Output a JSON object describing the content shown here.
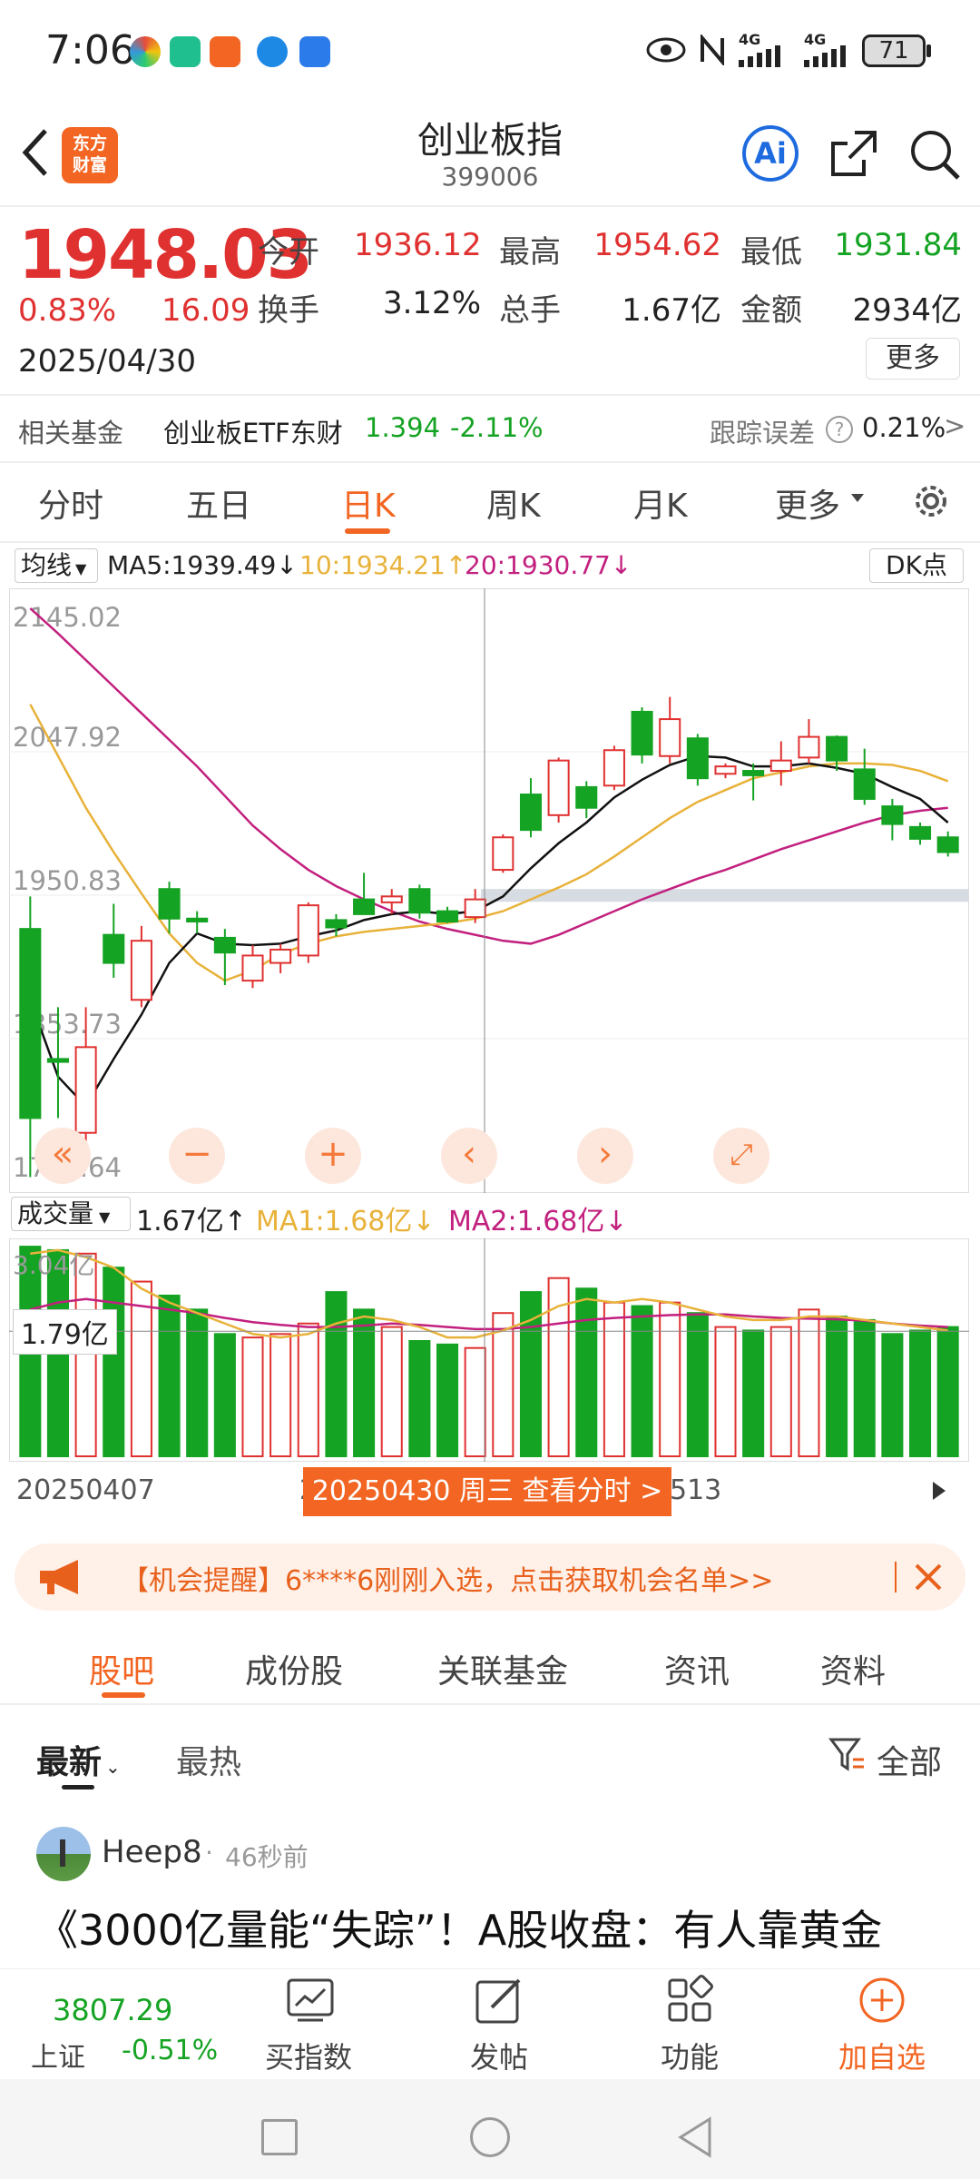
{
  "status_bar": {
    "time": "7:06",
    "network1": "4G",
    "network2": "4G",
    "battery": "71"
  },
  "header": {
    "title": "创业板指",
    "code": "399006",
    "logo_text": "东方财富",
    "ai_label": "Ai"
  },
  "quote": {
    "price": "1948.03",
    "change_pct": "0.83%",
    "change": "16.09",
    "date": "2025/04/30",
    "open_label": "今开",
    "open": "1936.12",
    "high_label": "最高",
    "high": "1954.62",
    "low_label": "最低",
    "low": "1931.84",
    "turnover_label": "换手",
    "turnover": "3.12%",
    "volume_label": "总手",
    "volume": "1.67亿",
    "amount_label": "金额",
    "amount": "2934亿",
    "more_label": "更多"
  },
  "fund": {
    "label": "相关基金",
    "name": "创业板ETF东财",
    "price": "1.394",
    "change": "-2.11%",
    "tracking_label": "跟踪误差",
    "tracking_value": "0.21%",
    "arrow": ">"
  },
  "chart_tabs": [
    "分时",
    "五日",
    "日K",
    "周K",
    "月K",
    "更多"
  ],
  "ma_bar": {
    "selector": "均线",
    "ma5": "MA5:1939.49↓",
    "ma10": "10:1934.21↑",
    "ma20": "20:1930.77↓",
    "dk": "DK点"
  },
  "vol_bar": {
    "selector": "成交量",
    "vol": "1.67亿↑",
    "ma1": "MA1:1.68亿↓",
    "ma2": "MA2:1.68亿↓",
    "tick_top": "3.04亿",
    "hover_value": "1.79亿"
  },
  "date_axis": {
    "start": "20250407",
    "pill": "20250430 周三 查看分时 >",
    "left_partial": "202",
    "right_partial": "513"
  },
  "reminder": {
    "text": "【机会提醒】6****6刚刚入选，点击获取机会名单>>"
  },
  "sub_tabs": [
    "股吧",
    "成份股",
    "关联基金",
    "资讯",
    "资料"
  ],
  "filter": {
    "latest": "最新",
    "hot": "最热",
    "all": "全部"
  },
  "post": {
    "user": "Heep8",
    "time": "46秒前",
    "title": "《3000亿量能“失踪”！A股收盘：有人靠黄金"
  },
  "bottom_bar": {
    "index_value": "3807.29",
    "index_name": "上证",
    "index_change": "-0.51%",
    "items": [
      "买指数",
      "发帖",
      "功能",
      "加自选"
    ]
  },
  "colors": {
    "up": "#e03131",
    "down": "#15a323",
    "accent": "#f26522",
    "ma5": "#111111",
    "ma10": "#e8b23a",
    "ma20": "#c2207e"
  },
  "chart_data": {
    "type": "candlestick",
    "y_ticks": [
      "2145.02",
      "2047.92",
      "1950.83",
      "1853.73",
      "1756.64"
    ],
    "ylim": [
      1756.64,
      2145.02
    ],
    "candles": [
      {
        "o": 1928,
        "c": 1800,
        "h": 1950,
        "l": 1760
      },
      {
        "o": 1840,
        "c": 1838,
        "h": 1875,
        "l": 1800
      },
      {
        "o": 1790,
        "c": 1848,
        "h": 1875,
        "l": 1770
      },
      {
        "o": 1924,
        "c": 1905,
        "h": 1945,
        "l": 1895
      },
      {
        "o": 1880,
        "c": 1920,
        "h": 1930,
        "l": 1875
      },
      {
        "o": 1955,
        "c": 1935,
        "h": 1960,
        "l": 1925
      },
      {
        "o": 1935,
        "c": 1933,
        "h": 1940,
        "l": 1925
      },
      {
        "o": 1922,
        "c": 1912,
        "h": 1928,
        "l": 1890
      },
      {
        "o": 1893,
        "c": 1910,
        "h": 1917,
        "l": 1888
      },
      {
        "o": 1905,
        "c": 1914,
        "h": 1918,
        "l": 1898
      },
      {
        "o": 1910,
        "c": 1944,
        "h": 1946,
        "l": 1905
      },
      {
        "o": 1934,
        "c": 1929,
        "h": 1938,
        "l": 1923
      },
      {
        "o": 1948,
        "c": 1938,
        "h": 1966,
        "l": 1938
      },
      {
        "o": 1946,
        "c": 1950,
        "h": 1955,
        "l": 1938
      },
      {
        "o": 1955,
        "c": 1939,
        "h": 1958,
        "l": 1935
      },
      {
        "o": 1940,
        "c": 1933,
        "h": 1943,
        "l": 1932
      },
      {
        "o": 1936,
        "c": 1948,
        "h": 1955,
        "l": 1932
      },
      {
        "o": 1968,
        "c": 1990,
        "h": 1992,
        "l": 1966
      },
      {
        "o": 2019,
        "c": 1995,
        "h": 2030,
        "l": 1990
      },
      {
        "o": 2005,
        "c": 2042,
        "h": 2044,
        "l": 2000
      },
      {
        "o": 2024,
        "c": 2010,
        "h": 2028,
        "l": 2003
      },
      {
        "o": 2025,
        "c": 2049,
        "h": 2052,
        "l": 2022
      },
      {
        "o": 2075,
        "c": 2046,
        "h": 2078,
        "l": 2040
      },
      {
        "o": 2045,
        "c": 2070,
        "h": 2085,
        "l": 2040
      },
      {
        "o": 2057,
        "c": 2030,
        "h": 2060,
        "l": 2025
      },
      {
        "o": 2033,
        "c": 2038,
        "h": 2040,
        "l": 2030
      },
      {
        "o": 2035,
        "c": 2032,
        "h": 2040,
        "l": 2015
      },
      {
        "o": 2035,
        "c": 2042,
        "h": 2055,
        "l": 2025
      },
      {
        "o": 2044,
        "c": 2058,
        "h": 2070,
        "l": 2040
      },
      {
        "o": 2058,
        "c": 2042,
        "h": 2059,
        "l": 2035
      },
      {
        "o": 2036,
        "c": 2016,
        "h": 2050,
        "l": 2012
      },
      {
        "o": 2011,
        "c": 1999,
        "h": 2016,
        "l": 1988
      },
      {
        "o": 1997,
        "c": 1989,
        "h": 2000,
        "l": 1985
      },
      {
        "o": 1990,
        "c": 1980,
        "h": 1994,
        "l": 1977
      }
    ],
    "ma5": [
      1880,
      1828,
      1808,
      1840,
      1870,
      1905,
      1925,
      1918,
      1917,
      1918,
      1923,
      1927,
      1934,
      1938,
      1940,
      1938,
      1940,
      1950,
      1969,
      1986,
      2000,
      2017,
      2029,
      2039,
      2045,
      2044,
      2038,
      2038,
      2040,
      2037,
      2033,
      2024,
      2016,
      2000
    ],
    "ma10": [
      2080,
      2045,
      2010,
      1980,
      1952,
      1925,
      1905,
      1893,
      1900,
      1911,
      1918,
      1923,
      1926,
      1928,
      1930,
      1932,
      1935,
      1940,
      1948,
      1956,
      1965,
      1977,
      1990,
      2003,
      2014,
      2022,
      2030,
      2034,
      2038,
      2040,
      2040,
      2039,
      2035,
      2028
    ],
    "ma20": [
      2145,
      2128,
      2110,
      2092,
      2074,
      2056,
      2038,
      2018,
      1998,
      1982,
      1968,
      1957,
      1948,
      1940,
      1933,
      1928,
      1924,
      1920,
      1918,
      1924,
      1932,
      1940,
      1948,
      1955,
      1962,
      1968,
      1975,
      1982,
      1988,
      1994,
      2000,
      2005,
      2008,
      2010
    ],
    "volume": {
      "ylim": [
        0,
        3.04
      ],
      "values": [
        3.0,
        2.95,
        2.9,
        2.7,
        2.5,
        2.3,
        2.1,
        1.75,
        1.7,
        1.75,
        1.9,
        2.35,
        2.1,
        1.85,
        1.65,
        1.6,
        1.55,
        2.05,
        2.35,
        2.55,
        2.4,
        2.2,
        2.15,
        2.2,
        2.05,
        1.85,
        1.8,
        1.85,
        2.1,
        2.0,
        1.95,
        1.75,
        1.8,
        1.85
      ],
      "ma1": [
        2.9,
        2.95,
        2.85,
        2.7,
        2.4,
        2.2,
        2.05,
        1.9,
        1.75,
        1.7,
        1.75,
        1.9,
        2.0,
        1.95,
        1.85,
        1.7,
        1.7,
        1.8,
        1.95,
        2.15,
        2.25,
        2.2,
        2.25,
        2.2,
        2.1,
        2.0,
        1.95,
        1.95,
        2.0,
        2.0,
        1.95,
        1.9,
        1.85,
        1.8
      ],
      "ma2": [
        2.1,
        2.2,
        2.25,
        2.2,
        2.15,
        2.1,
        2.05,
        1.98,
        1.92,
        1.88,
        1.85,
        1.85,
        1.87,
        1.9,
        1.88,
        1.85,
        1.82,
        1.82,
        1.85,
        1.9,
        1.95,
        1.98,
        2.0,
        2.02,
        2.03,
        2.03,
        2.0,
        1.98,
        1.97,
        1.96,
        1.94,
        1.9,
        1.87,
        1.85
      ]
    }
  }
}
